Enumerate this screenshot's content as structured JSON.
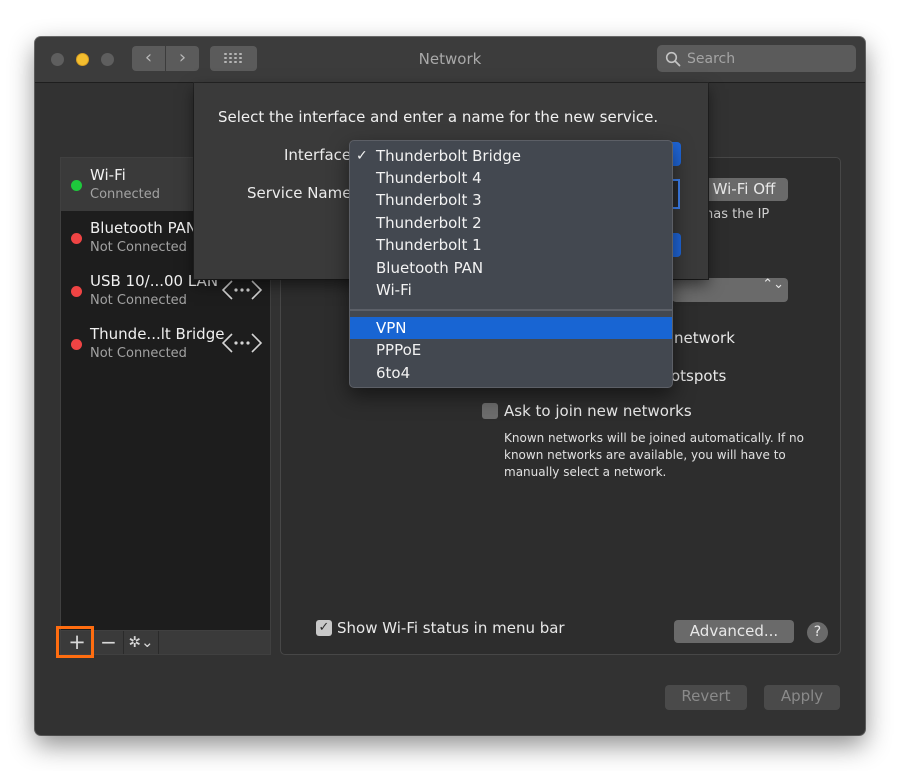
{
  "window": {
    "title": "Network",
    "search_placeholder": "Search"
  },
  "titlebar": {
    "back_glyph": "‹",
    "forward_glyph": "›"
  },
  "services": [
    {
      "name": "Wi-Fi",
      "status": "Connected",
      "state": "green"
    },
    {
      "name": "Bluetooth PAN",
      "status": "Not Connected",
      "state": "red"
    },
    {
      "name": "USB 10/...00 LAN",
      "status": "Not Connected",
      "state": "red"
    },
    {
      "name": "Thunde...lt Bridge",
      "status": "Not Connected",
      "state": "red"
    }
  ],
  "list_toolbar": {
    "add": "+",
    "remove": "−",
    "actions": "✲⌄"
  },
  "sheet": {
    "prompt": "Select the interface and enter a name for the new service.",
    "interface_label": "Interface",
    "service_name_label": "Service Name"
  },
  "interface_menu": {
    "check": "✓",
    "selected_index": 0,
    "highlighted_index": 7,
    "items": [
      "Thunderbolt Bridge",
      "Thunderbolt 4",
      "Thunderbolt 3",
      "Thunderbolt 2",
      "Thunderbolt 1",
      "Bluetooth PAN",
      "Wi-Fi",
      "VPN",
      "PPPoE",
      "6to4"
    ]
  },
  "detail": {
    "wifi_off_button": "Wi-Fi Off",
    "ip_text": "has the IP",
    "network_partial": "network",
    "hotspots_partial": "otspots",
    "popup_arrows": "⌃⌄",
    "ask_networks_label": "Ask to join new networks",
    "ask_networks_desc": "Known networks will be joined automatically. If no known networks are available, you will have to manually select a network.",
    "show_wifi_label": "Show Wi-Fi status in menu bar",
    "show_wifi_check": "✓",
    "advanced_button": "Advanced...",
    "help_button": "?",
    "revert_button": "Revert",
    "apply_button": "Apply"
  },
  "colors": {
    "accent": "#1865d3",
    "highlight_box": "#ff6d10",
    "connected": "#1ec93c",
    "not_connected": "#ef4444"
  }
}
